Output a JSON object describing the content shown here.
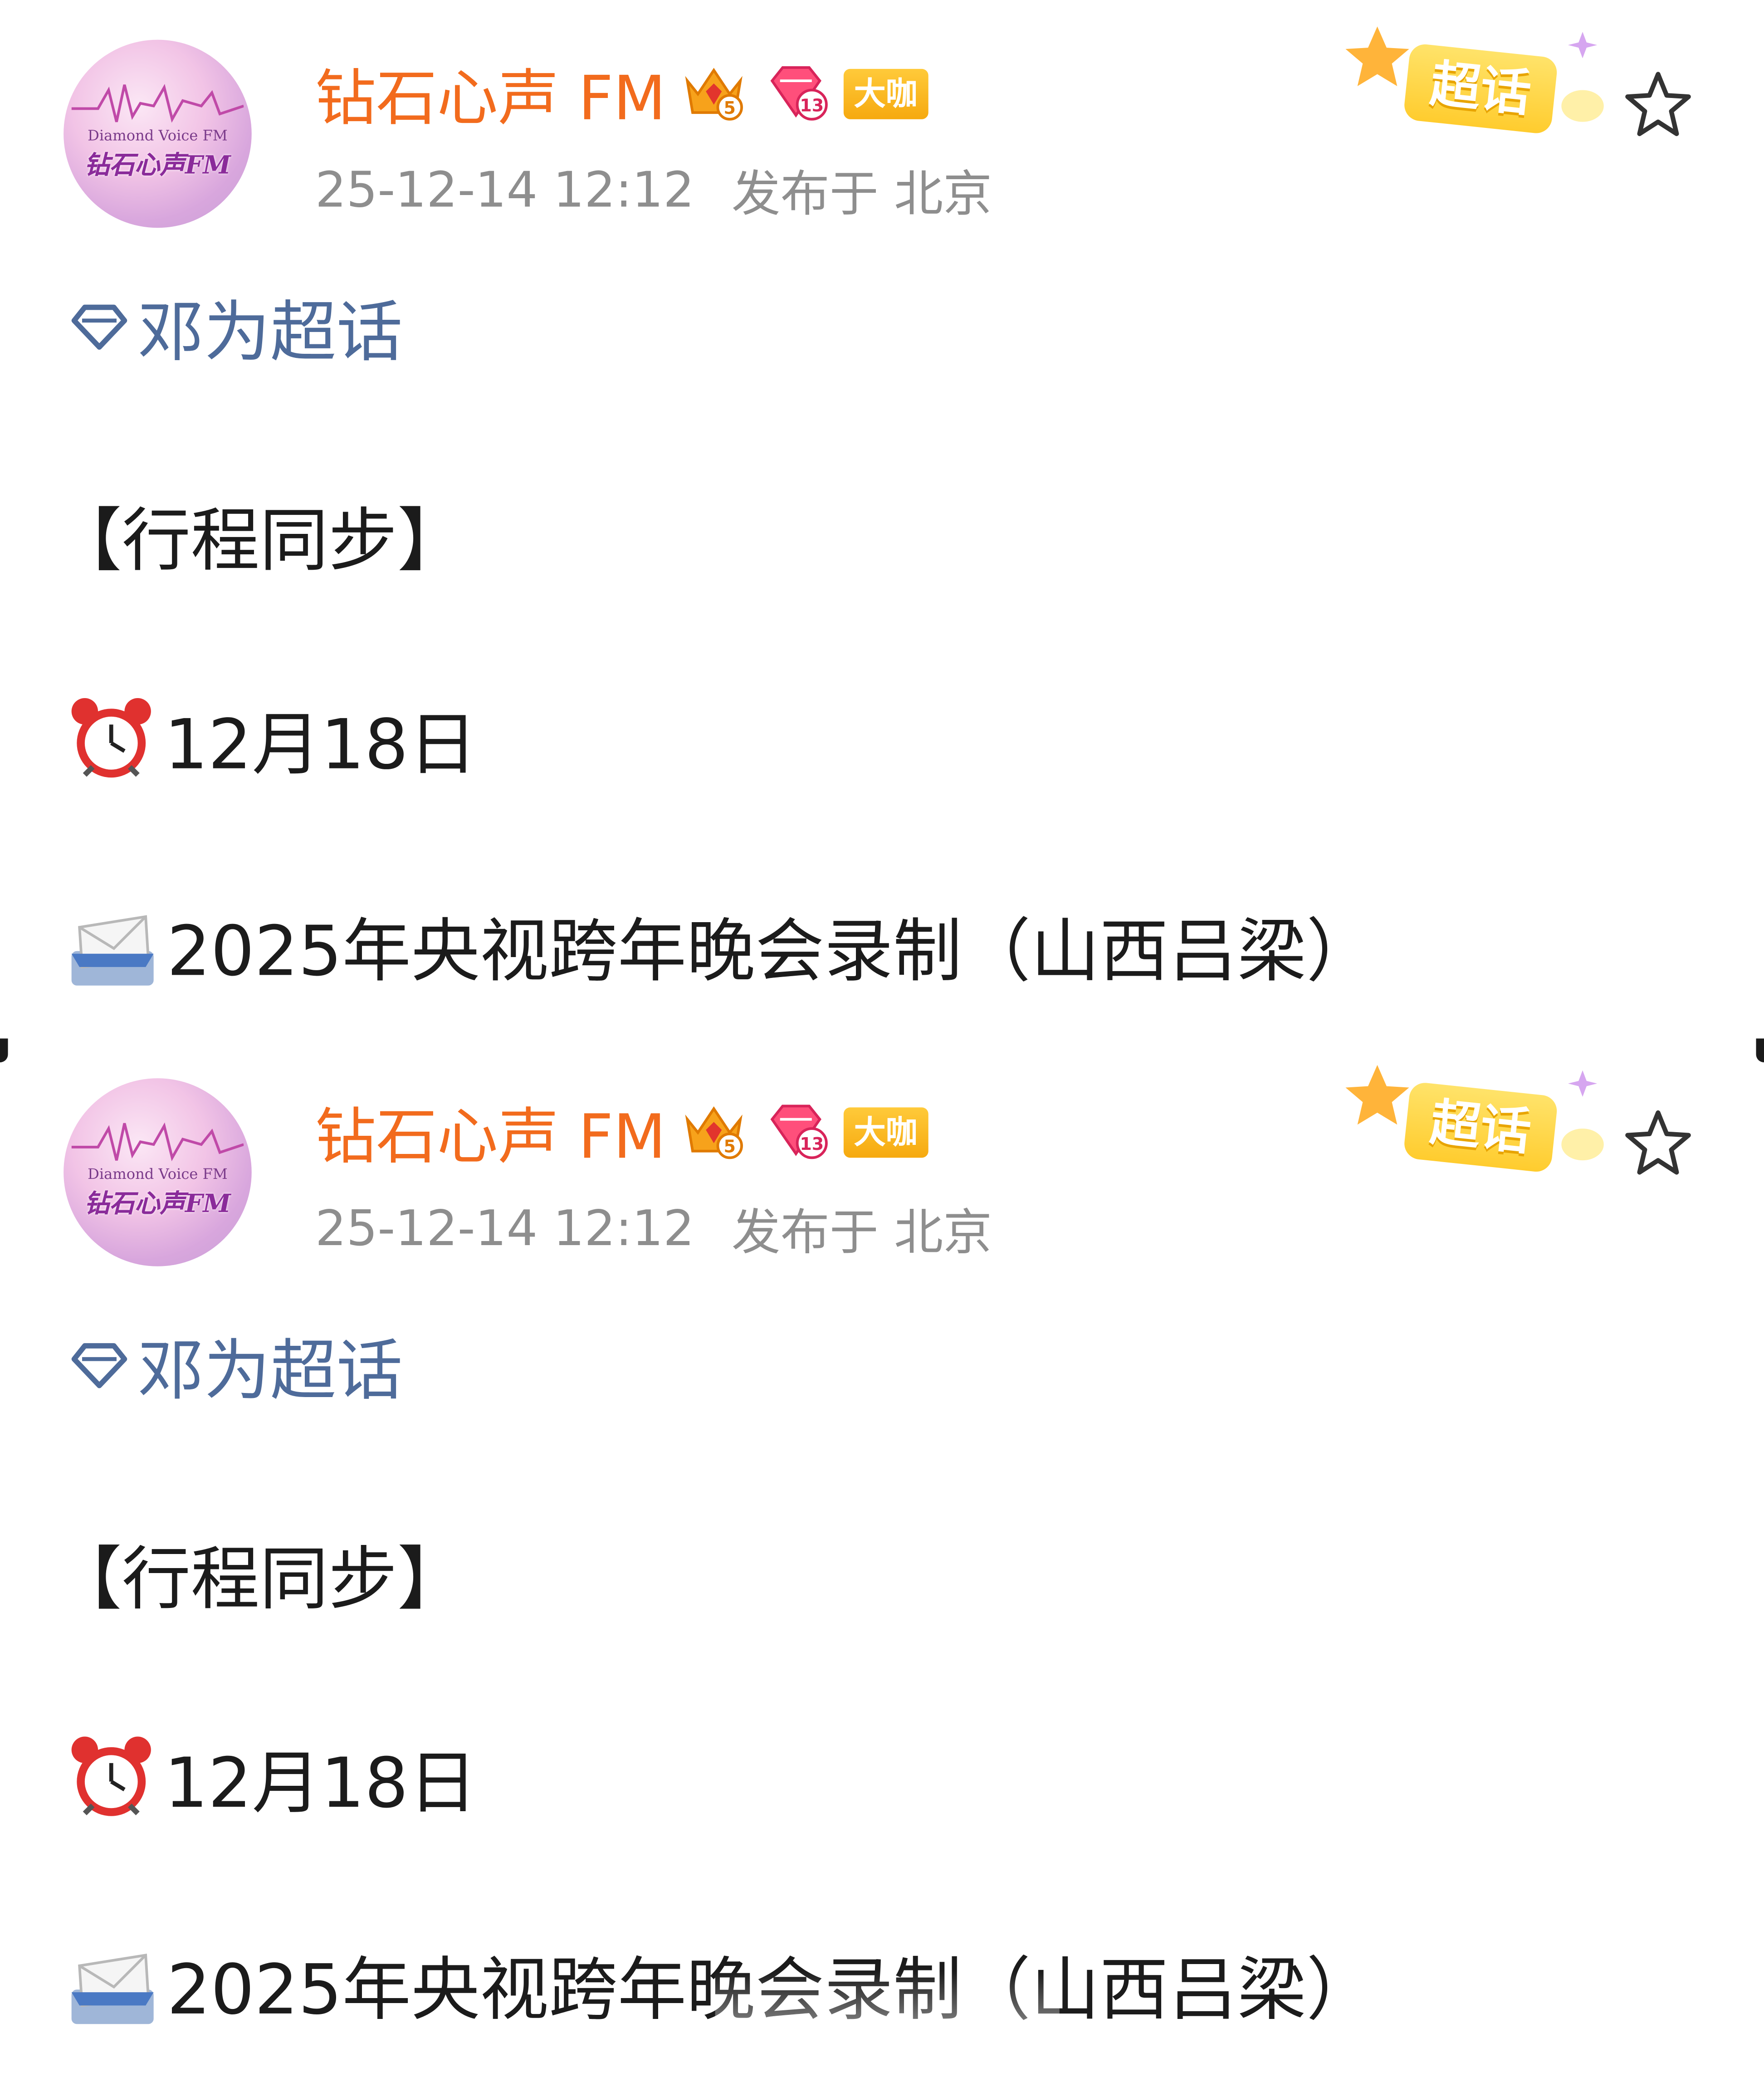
{
  "posts": [
    {
      "author": {
        "name": "钻石心声 FM",
        "avatar_line1": "Diamond Voice FM",
        "avatar_line2": "钻石心声FM",
        "crown_level": "5",
        "diamond_level": "13",
        "role_badge": "大咖"
      },
      "meta": {
        "timestamp": "25-12-14 12:12",
        "location": "发布于 北京"
      },
      "sticker_label": "超话",
      "topic": "邓为超话",
      "lines": {
        "heading": "【行程同步】",
        "date": "12月18日",
        "event": "2025年央视跨年晚会录制（山西吕梁）"
      }
    },
    {
      "author": {
        "name": "钻石心声 FM",
        "avatar_line1": "Diamond Voice FM",
        "avatar_line2": "钻石心声FM",
        "crown_level": "5",
        "diamond_level": "13",
        "role_badge": "大咖"
      },
      "meta": {
        "timestamp": "25-12-14 12:12",
        "location": "发布于 北京"
      },
      "sticker_label": "超话",
      "topic": "邓为超话",
      "lines": {
        "heading": "【行程同步】",
        "date": "12月18日",
        "event": "2025年央视跨年晚会录制（山西吕梁）"
      }
    }
  ],
  "icons": {
    "crown": "crown-icon",
    "diamond_badge": "diamond-badge-icon",
    "topic": "diamond-outline-icon",
    "clock": "alarm-clock-icon",
    "mail": "incoming-envelope-icon",
    "favorite": "star-outline-icon"
  },
  "colors": {
    "username": "#f26b1d",
    "meta": "#8e8e8e",
    "topic": "#4e6b9a",
    "body_text": "#1b1b1b",
    "badge_gold": "#f6a90f"
  }
}
